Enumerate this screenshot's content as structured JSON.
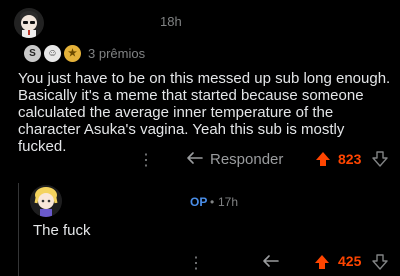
{
  "comment": {
    "timestamp": "18h",
    "awards": {
      "icons": [
        "silver-award-icon",
        "wholesome-award-icon",
        "gold-award-icon"
      ],
      "count_label": "3  prêmios"
    },
    "body": "You just have to be on this messed up sub long enough. Basically it's a meme that started because someone calculated the average inner temperature of the character Asuka's vagina. Yeah this sub is mostly fucked.",
    "actions": {
      "more": "⋮",
      "reply_label": "Responder",
      "score": "823"
    }
  },
  "reply": {
    "op_badge": "OP",
    "separator": "•",
    "timestamp": "17h",
    "body": "The fuck",
    "actions": {
      "more": "⋮",
      "score": "425"
    }
  },
  "colors": {
    "background": "#000000",
    "upvote": "#ff4500",
    "op": "#4a8ee8",
    "muted": "#818384"
  }
}
